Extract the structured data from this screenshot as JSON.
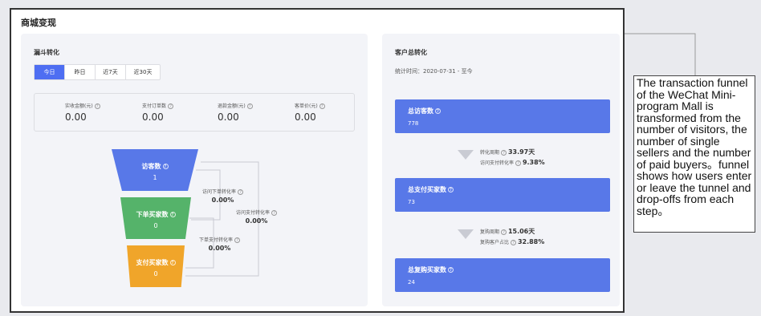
{
  "page": {
    "title": "商城变现"
  },
  "funnel_panel": {
    "title": "漏斗转化",
    "tabs": [
      {
        "label": "今日",
        "active": true
      },
      {
        "label": "昨日",
        "active": false
      },
      {
        "label": "近7天",
        "active": false
      },
      {
        "label": "近30天",
        "active": false
      }
    ],
    "metrics": [
      {
        "label": "实收金额(元)",
        "value": "0.00"
      },
      {
        "label": "支付订单数",
        "value": "0.00"
      },
      {
        "label": "退款金额(元)",
        "value": "0.00"
      },
      {
        "label": "客单价(元)",
        "value": "0.00"
      }
    ],
    "steps": [
      {
        "label": "访客数",
        "value": "1",
        "color": "#5878e8"
      },
      {
        "label": "下单买家数",
        "value": "0",
        "color": "#55b36a"
      },
      {
        "label": "支付买家数",
        "value": "0",
        "color": "#f0a52a"
      }
    ],
    "rates": {
      "visit_order": {
        "label": "访问下单转化率",
        "value": "0.00%"
      },
      "visit_pay": {
        "label": "访问支付转化率",
        "value": "0.00%"
      },
      "order_pay": {
        "label": "下单支付转化率",
        "value": "0.00%"
      }
    }
  },
  "customer_panel": {
    "title": "客户总转化",
    "stat_time": "统计时间：2020-07-31 - 至今",
    "cards": [
      {
        "label": "总访客数",
        "value": "778"
      },
      {
        "label": "总支付买家数",
        "value": "73"
      },
      {
        "label": "总复购买家数",
        "value": "24"
      }
    ],
    "conversions": [
      {
        "line1_label": "转化周期",
        "line1_value": "33.97天",
        "line2_label": "访问支付转化率",
        "line2_value": "9.38%"
      },
      {
        "line1_label": "复购周期",
        "line1_value": "15.06天",
        "line2_label": "复购客户占比",
        "line2_value": "32.88%"
      }
    ]
  },
  "annotation": {
    "text": "The transaction funnel of the WeChat Mini-program Mall is transformed from the number of visitors, the number of single sellers and the number of paid buyers。funnel shows how users enter or leave the tunnel and drop-offs from each step。"
  },
  "colors": {
    "accent": "#4e6ef2",
    "card_blue": "#5878e8",
    "green": "#55b36a",
    "orange": "#f0a52a"
  },
  "icons": [
    "help-icon",
    "triangle-down-icon"
  ]
}
